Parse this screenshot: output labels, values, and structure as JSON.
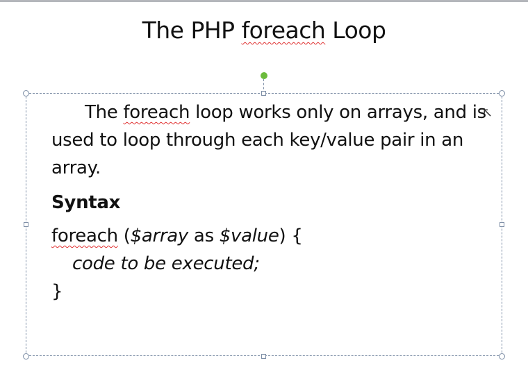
{
  "slide": {
    "title_prefix": "The PHP ",
    "title_keyword": "foreach",
    "title_suffix": " Loop",
    "intro": {
      "pre": "The ",
      "keyword": "foreach",
      "post": " loop works only on arrays, and is used to loop through each key/value pair in an array."
    },
    "syntax_heading": "Syntax",
    "code": {
      "keyword": "foreach",
      "open": " (",
      "array_var": "$array",
      "as": " as ",
      "value_var": "$value",
      "close": ") {",
      "body": "code to be executed;",
      "end": "}"
    }
  },
  "colors": {
    "selection_border": "#7d8ea6",
    "rotate_handle": "#6cbb3c",
    "spellcheck": "#e03030"
  }
}
